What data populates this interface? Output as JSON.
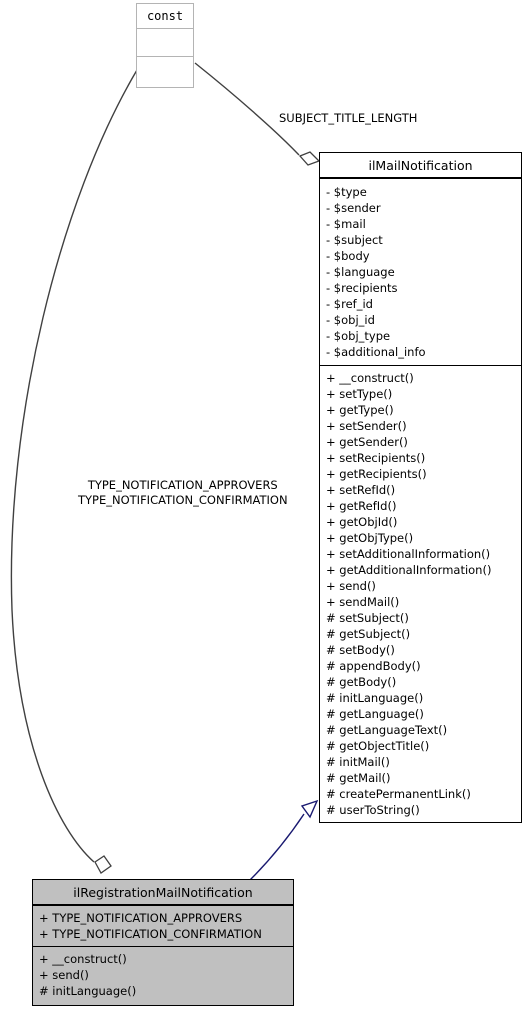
{
  "diagram": {
    "type": "uml-class-diagram",
    "background": "#ffffff",
    "colors": {
      "stub_border": "#b4b4b4",
      "class_border": "#000000",
      "class_fill": "#ffffff",
      "highlight_fill": "#c0c0c0",
      "aggregation_edge": "#404040",
      "inheritance_edge": "#1a1a8c",
      "text": "#000000"
    }
  },
  "const_stub": {
    "title": "const",
    "compartments": 2
  },
  "mail_notification": {
    "title": "ilMailNotification",
    "attributes": [
      "- $type",
      "- $sender",
      "- $mail",
      "- $subject",
      "- $body",
      "- $language",
      "- $recipients",
      "- $ref_id",
      "- $obj_id",
      "- $obj_type",
      "- $additional_info"
    ],
    "operations": [
      "+ __construct()",
      "+ setType()",
      "+ getType()",
      "+ setSender()",
      "+ getSender()",
      "+ setRecipients()",
      "+ getRecipients()",
      "+ setRefId()",
      "+ getRefId()",
      "+ getObjId()",
      "+ getObjType()",
      "+ setAdditionalInformation()",
      "+ getAdditionalInformation()",
      "+ send()",
      "+ sendMail()",
      "# setSubject()",
      "# getSubject()",
      "# setBody()",
      "# appendBody()",
      "# getBody()",
      "# initLanguage()",
      "# getLanguage()",
      "# getLanguageText()",
      "# getObjectTitle()",
      "# initMail()",
      "# getMail()",
      "# createPermanentLink()",
      "# userToString()"
    ]
  },
  "registration_mail_notification": {
    "title": "ilRegistrationMailNotification",
    "constants": [
      "+ TYPE_NOTIFICATION_APPROVERS",
      "+ TYPE_NOTIFICATION_CONFIRMATION"
    ],
    "operations": [
      "+ __construct()",
      "+ send()",
      "# initLanguage()"
    ]
  },
  "edges": {
    "const_to_mail_label": "SUBJECT_TITLE_LENGTH",
    "const_to_registration_label_line1": "TYPE_NOTIFICATION_APPROVERS",
    "const_to_registration_label_line2": "TYPE_NOTIFICATION_CONFIRMATION"
  }
}
